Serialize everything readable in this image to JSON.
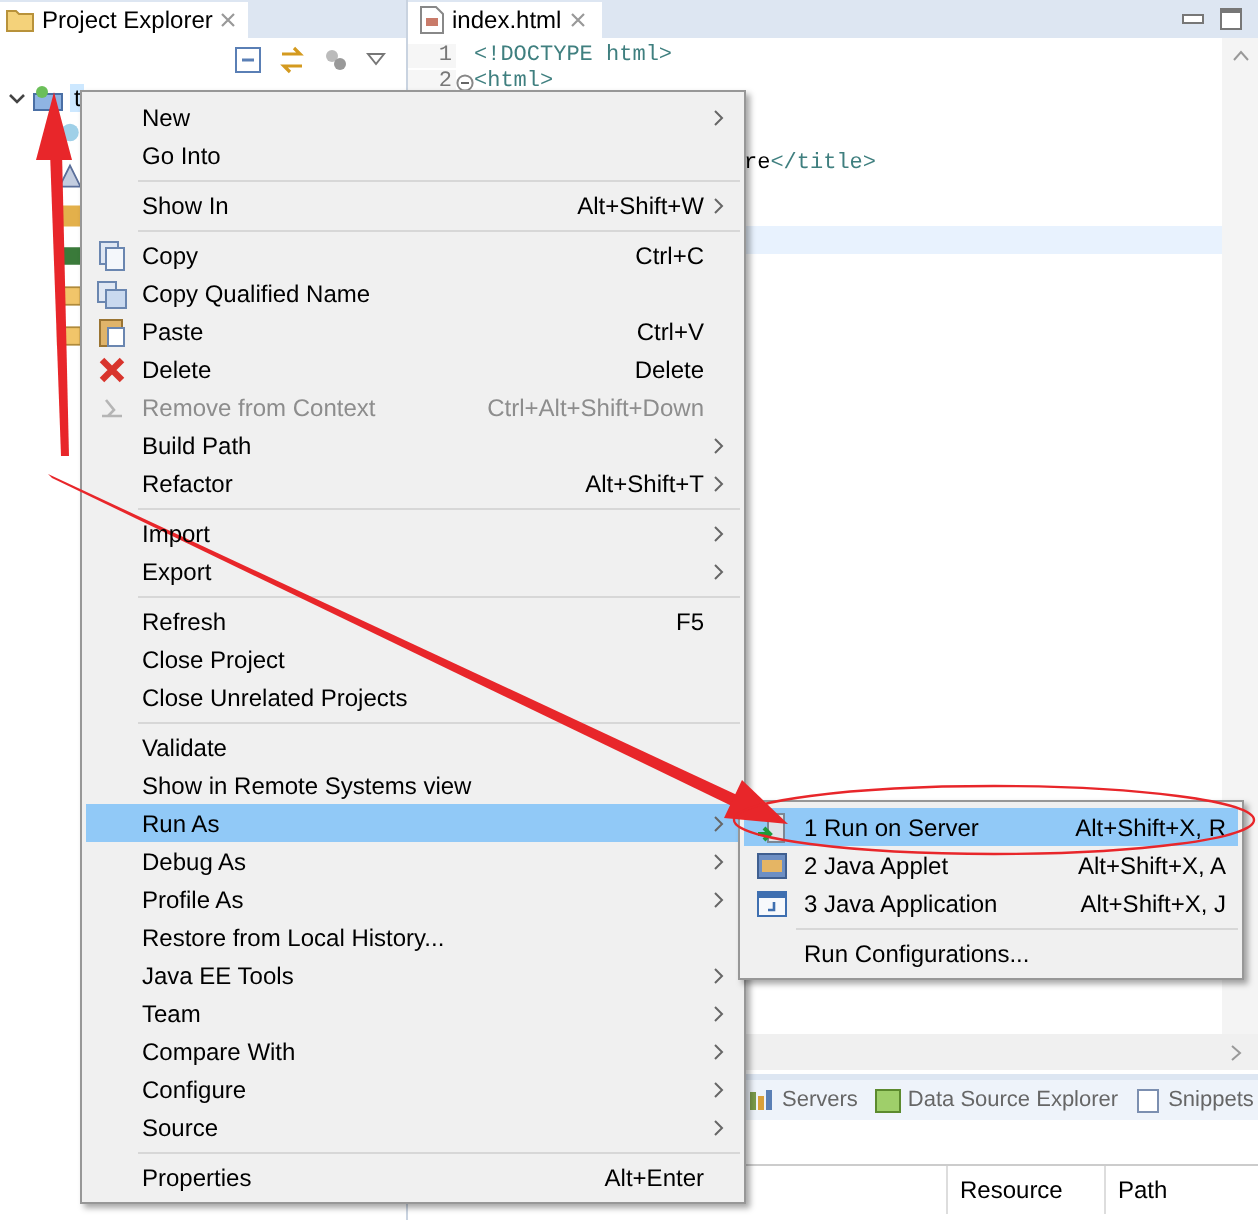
{
  "project_explorer": {
    "title": "Project Explorer",
    "tree": [
      {
        "label": "t",
        "selected": true,
        "expanded": true
      }
    ]
  },
  "editor": {
    "tab": "index.html",
    "lines": [
      {
        "number": "1",
        "text": "<!DOCTYPE html>"
      },
      {
        "number": "2",
        "text": "<html>"
      }
    ],
    "partial_line": [
      {
        "kind": "text",
        "text": "re"
      },
      {
        "kind": "tag",
        "text": "</title>"
      }
    ]
  },
  "context_menu": {
    "items": [
      {
        "kind": "item",
        "label": "New",
        "submenu": true,
        "disabled": false,
        "selected": false
      },
      {
        "kind": "item",
        "label": "Go Into",
        "submenu": false,
        "disabled": false,
        "selected": false
      },
      {
        "kind": "separator"
      },
      {
        "kind": "item",
        "label": "Show In",
        "shortcut": "Alt+Shift+W",
        "submenu": true,
        "disabled": false,
        "selected": false
      },
      {
        "kind": "separator"
      },
      {
        "kind": "item",
        "label": "Copy",
        "shortcut": "Ctrl+C",
        "submenu": false,
        "disabled": false,
        "selected": false
      },
      {
        "kind": "item",
        "label": "Copy Qualified Name",
        "submenu": false,
        "disabled": false,
        "selected": false
      },
      {
        "kind": "item",
        "label": "Paste",
        "shortcut": "Ctrl+V",
        "submenu": false,
        "disabled": false,
        "selected": false
      },
      {
        "kind": "item",
        "label": "Delete",
        "shortcut": "Delete",
        "submenu": false,
        "disabled": false,
        "selected": false
      },
      {
        "kind": "item",
        "label": "Remove from Context",
        "shortcut": "Ctrl+Alt+Shift+Down",
        "submenu": false,
        "disabled": true,
        "selected": false
      },
      {
        "kind": "item",
        "label": "Build Path",
        "submenu": true,
        "disabled": false,
        "selected": false
      },
      {
        "kind": "item",
        "label": "Refactor",
        "shortcut": "Alt+Shift+T",
        "submenu": true,
        "disabled": false,
        "selected": false
      },
      {
        "kind": "separator"
      },
      {
        "kind": "item",
        "label": "Import",
        "submenu": true,
        "disabled": false,
        "selected": false
      },
      {
        "kind": "item",
        "label": "Export",
        "submenu": true,
        "disabled": false,
        "selected": false
      },
      {
        "kind": "separator"
      },
      {
        "kind": "item",
        "label": "Refresh",
        "shortcut": "F5",
        "submenu": false,
        "disabled": false,
        "selected": false
      },
      {
        "kind": "item",
        "label": "Close Project",
        "submenu": false,
        "disabled": false,
        "selected": false
      },
      {
        "kind": "item",
        "label": "Close Unrelated Projects",
        "submenu": false,
        "disabled": false,
        "selected": false
      },
      {
        "kind": "separator"
      },
      {
        "kind": "item",
        "label": "Validate",
        "submenu": false,
        "disabled": false,
        "selected": false
      },
      {
        "kind": "item",
        "label": "Show in Remote Systems view",
        "submenu": false,
        "disabled": false,
        "selected": false
      },
      {
        "kind": "item",
        "label": "Run As",
        "submenu": true,
        "disabled": false,
        "selected": true
      },
      {
        "kind": "item",
        "label": "Debug As",
        "submenu": true,
        "disabled": false,
        "selected": false
      },
      {
        "kind": "item",
        "label": "Profile As",
        "submenu": true,
        "disabled": false,
        "selected": false
      },
      {
        "kind": "item",
        "label": "Restore from Local History...",
        "submenu": false,
        "disabled": false,
        "selected": false
      },
      {
        "kind": "item",
        "label": "Java EE Tools",
        "submenu": true,
        "disabled": false,
        "selected": false
      },
      {
        "kind": "item",
        "label": "Team",
        "submenu": true,
        "disabled": false,
        "selected": false
      },
      {
        "kind": "item",
        "label": "Compare With",
        "submenu": true,
        "disabled": false,
        "selected": false
      },
      {
        "kind": "item",
        "label": "Configure",
        "submenu": true,
        "disabled": false,
        "selected": false
      },
      {
        "kind": "item",
        "label": "Source",
        "submenu": true,
        "disabled": false,
        "selected": false
      },
      {
        "kind": "separator"
      },
      {
        "kind": "item",
        "label": "Properties",
        "shortcut": "Alt+Enter",
        "submenu": false,
        "disabled": false,
        "selected": false
      }
    ]
  },
  "submenu": {
    "items": [
      {
        "kind": "item",
        "label": "1 Run on Server",
        "shortcut": "Alt+Shift+X, R",
        "selected": true
      },
      {
        "kind": "item",
        "label": "2 Java Applet",
        "shortcut": "Alt+Shift+X, A",
        "selected": false
      },
      {
        "kind": "item",
        "label": "3 Java Application",
        "shortcut": "Alt+Shift+X, J",
        "selected": false
      },
      {
        "kind": "separator"
      },
      {
        "kind": "item",
        "label": "Run Configurations...",
        "selected": false
      }
    ]
  },
  "bottom_panel": {
    "tabs": [
      {
        "label": "Servers"
      },
      {
        "label": "Data Source Explorer"
      },
      {
        "label": "Snippets"
      }
    ],
    "columns": [
      "Resource",
      "Path"
    ]
  }
}
